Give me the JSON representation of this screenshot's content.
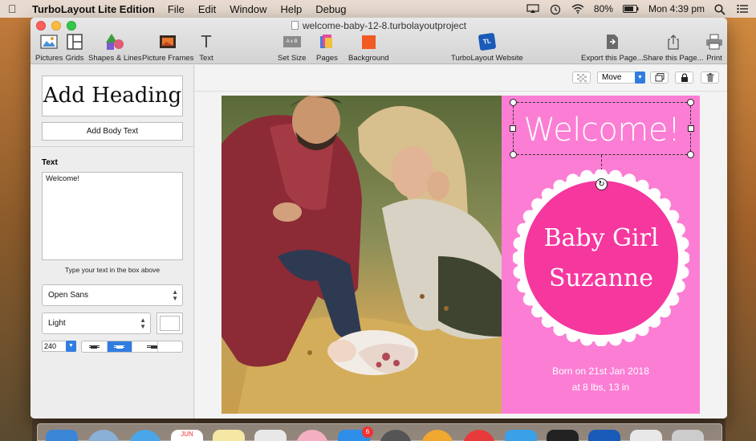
{
  "menubar": {
    "app_name": "TurboLayout Lite Edition",
    "menus": [
      "File",
      "Edit",
      "Window",
      "Help",
      "Debug"
    ],
    "battery": "80%",
    "clock": "Mon 4:39 pm"
  },
  "window": {
    "doc_title": "welcome-baby-12-8.turbolayoutproject"
  },
  "toolbar": {
    "pictures": "Pictures",
    "grids": "Grids",
    "shapes": "Shapes & Lines",
    "frames": "Picture Frames",
    "text": "Text",
    "set_size": "Set Size",
    "set_size_icon_text": "A x B",
    "pages": "Pages",
    "background": "Background",
    "website": "TurboLayout Website",
    "website_icon_text": "TL",
    "export": "Export this Page...",
    "share": "Share this Page...",
    "print": "Print"
  },
  "leftpanel": {
    "add_heading": "Add Heading",
    "add_body": "Add Body Text",
    "text_label": "Text",
    "text_value": "Welcome!",
    "hint": "Type your text in the box above",
    "font": "Open Sans",
    "weight": "Light",
    "size": "240"
  },
  "canvas_toolbar": {
    "mode": "Move"
  },
  "page": {
    "welcome": "Welcome!",
    "badge_line1": "Baby Girl",
    "badge_line2": "Suzanne",
    "born_line1": "Born on 21st Jan 2018",
    "born_line2": "at 8 lbs, 13 in"
  },
  "dock": {
    "calendar_month": "JUN",
    "badge_count": "6"
  },
  "colors": {
    "page_pink": "#fb7ed4",
    "badge_pink": "#f5379e",
    "accent_blue": "#2f7de1"
  }
}
